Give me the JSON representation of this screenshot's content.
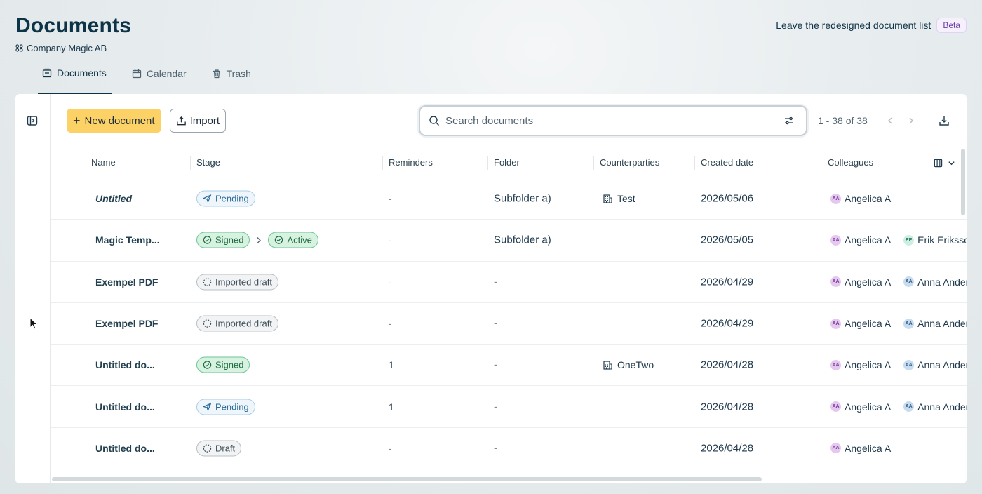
{
  "header": {
    "title": "Documents",
    "company": "Company Magic AB",
    "leave_text": "Leave the redesigned document list",
    "beta_label": "Beta"
  },
  "tabs": [
    {
      "label": "Documents",
      "icon": "documents-icon",
      "active": true
    },
    {
      "label": "Calendar",
      "icon": "calendar-icon",
      "active": false
    },
    {
      "label": "Trash",
      "icon": "trash-icon",
      "active": false
    }
  ],
  "toolbar": {
    "new_label": "New document",
    "import_label": "Import",
    "search_placeholder": "Search documents",
    "pager_text": "1 - 38 of 38"
  },
  "columns": [
    "Name",
    "Stage",
    "Reminders",
    "Folder",
    "Counterparties",
    "Created date",
    "Colleagues"
  ],
  "rows": [
    {
      "name": "Untitled",
      "italic": true,
      "stages": [
        {
          "label": "Pending",
          "type": "pending"
        }
      ],
      "reminders": "-",
      "folder": "Subfolder a)",
      "counterparty": "Test",
      "created": "2026/05/06",
      "colleagues": [
        {
          "initials": "AA",
          "name": "Angelica A",
          "color": "aa"
        }
      ]
    },
    {
      "name": "Magic Temp...",
      "italic": false,
      "stages": [
        {
          "label": "Signed",
          "type": "signed"
        },
        {
          "label": "Active",
          "type": "active"
        }
      ],
      "reminders": "-",
      "folder": "Subfolder a)",
      "counterparty": "",
      "created": "2026/05/05",
      "colleagues": [
        {
          "initials": "AA",
          "name": "Angelica A",
          "color": "aa"
        },
        {
          "initials": "EE",
          "name": "Erik Eriksso",
          "color": "ee"
        }
      ]
    },
    {
      "name": "Exempel PDF",
      "italic": false,
      "stages": [
        {
          "label": "Imported draft",
          "type": "draft"
        }
      ],
      "reminders": "-",
      "folder": "-",
      "counterparty": "",
      "created": "2026/04/29",
      "colleagues": [
        {
          "initials": "AA",
          "name": "Angelica A",
          "color": "aa"
        },
        {
          "initials": "AA",
          "name": "Anna Anders",
          "color": "an"
        }
      ]
    },
    {
      "name": "Exempel PDF",
      "italic": false,
      "stages": [
        {
          "label": "Imported draft",
          "type": "draft"
        }
      ],
      "reminders": "-",
      "folder": "-",
      "counterparty": "",
      "created": "2026/04/29",
      "colleagues": [
        {
          "initials": "AA",
          "name": "Angelica A",
          "color": "aa"
        },
        {
          "initials": "AA",
          "name": "Anna Anders",
          "color": "an"
        }
      ]
    },
    {
      "name": "Untitled do...",
      "italic": false,
      "stages": [
        {
          "label": "Signed",
          "type": "signed"
        }
      ],
      "reminders": "1",
      "folder": "-",
      "counterparty": "OneTwo",
      "created": "2026/04/28",
      "colleagues": [
        {
          "initials": "AA",
          "name": "Angelica A",
          "color": "aa"
        },
        {
          "initials": "AA",
          "name": "Anna Anders",
          "color": "an"
        }
      ]
    },
    {
      "name": "Untitled do...",
      "italic": false,
      "stages": [
        {
          "label": "Pending",
          "type": "pending"
        }
      ],
      "reminders": "1",
      "folder": "-",
      "counterparty": "",
      "created": "2026/04/28",
      "colleagues": [
        {
          "initials": "AA",
          "name": "Angelica A",
          "color": "aa"
        },
        {
          "initials": "AA",
          "name": "Anna Anders",
          "color": "an"
        }
      ]
    },
    {
      "name": "Untitled do...",
      "italic": false,
      "stages": [
        {
          "label": "Draft",
          "type": "draft"
        }
      ],
      "reminders": "-",
      "folder": "-",
      "counterparty": "",
      "created": "2026/04/28",
      "colleagues": [
        {
          "initials": "AA",
          "name": "Angelica A",
          "color": "aa"
        }
      ]
    }
  ]
}
